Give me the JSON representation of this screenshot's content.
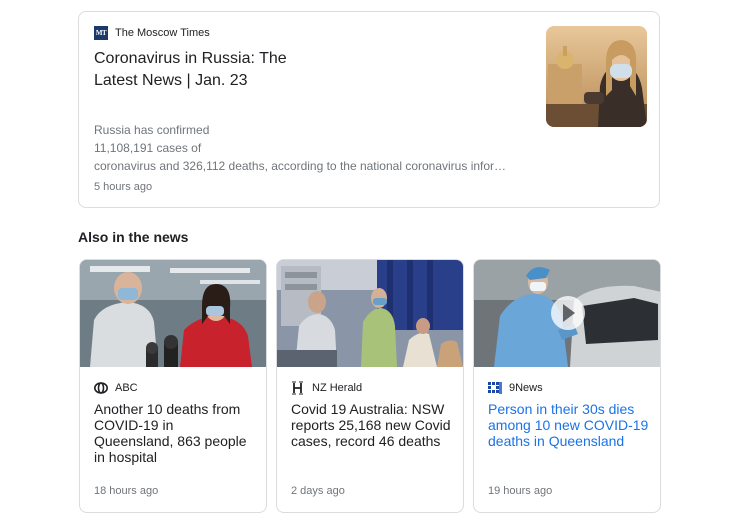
{
  "top_story": {
    "source": "The Moscow Times",
    "source_logo_text": "MT",
    "title": "Coronavirus in Russia: The Latest News | Jan. 23",
    "snippet_lines": [
      "Russia has confirmed",
      "11,108,191 cases of",
      "coronavirus and 326,112 deaths, according to the national coronavirus infor…"
    ],
    "time": "5 hours ago"
  },
  "also_in_news": {
    "heading": "Also in the news",
    "cards": [
      {
        "source": "ABC",
        "source_icon": "abc-logo-icon",
        "title": "Another 10 deaths from COVID-19 in Queensland, 863 people in hospital",
        "time": "18 hours ago",
        "is_link_color": false
      },
      {
        "source": "NZ Herald",
        "source_icon": "nz-herald-logo-icon",
        "title": "Covid 19 Australia: NSW reports 25,168 new Covid cases, record 46 deaths",
        "time": "2 days ago",
        "is_link_color": false
      },
      {
        "source": "9News",
        "source_icon": "9news-logo-icon",
        "title": "Person in their 30s dies among 10 new COVID-19 deaths in Queensland",
        "time": "19 hours ago",
        "is_link_color": true,
        "has_play_icon": true
      }
    ]
  },
  "colors": {
    "link_blue": "#1a73e8",
    "meta_gray": "#70757a",
    "border": "#dadce0"
  }
}
